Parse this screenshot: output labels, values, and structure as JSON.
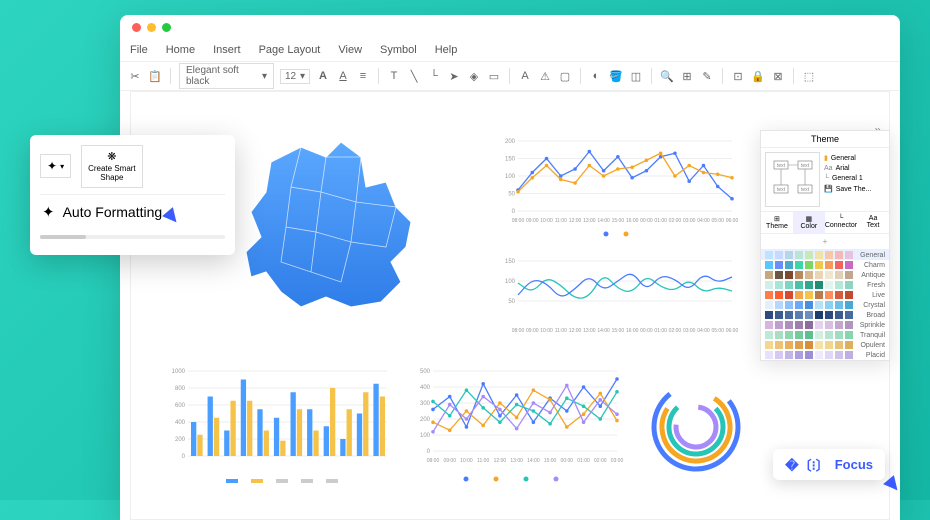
{
  "menu": {
    "file": "File",
    "home": "Home",
    "insert": "Insert",
    "layout": "Page Layout",
    "view": "View",
    "symbol": "Symbol",
    "help": "Help"
  },
  "toolbar": {
    "font": "Elegant soft black",
    "size": "12"
  },
  "popup": {
    "create_smart": "Create Smart\nShape",
    "auto_format": "Auto Formatting"
  },
  "theme": {
    "title": "Theme",
    "opts": [
      "General",
      "Arial",
      "General 1",
      "Save The..."
    ],
    "tabs": [
      "Theme",
      "Color",
      "Connector",
      "Text"
    ],
    "plus": "+",
    "rows": [
      "General",
      "Charm",
      "Antique",
      "Fresh",
      "Live",
      "Crystal",
      "Broad",
      "Sprinkle",
      "Tranquil",
      "Opulent",
      "Placid"
    ]
  },
  "focus": "Focus",
  "chart_data": [
    {
      "type": "line",
      "title": "",
      "x": [
        "08:00",
        "09:00",
        "10:00",
        "11:00",
        "12:00",
        "13:00",
        "14:00",
        "15:00",
        "16:00",
        "00:00",
        "01:00",
        "02:00",
        "03:00",
        "04:00",
        "05:00",
        "06:00"
      ],
      "series": [
        {
          "name": "blue",
          "values": [
            60,
            110,
            150,
            100,
            120,
            170,
            115,
            155,
            95,
            115,
            155,
            165,
            85,
            130,
            70,
            35
          ]
        },
        {
          "name": "yellow",
          "values": [
            55,
            95,
            130,
            90,
            80,
            130,
            100,
            120,
            125,
            145,
            165,
            100,
            130,
            110,
            105,
            95
          ]
        }
      ],
      "ylim": [
        0,
        200
      ],
      "yticks": [
        0,
        50,
        100,
        150,
        200
      ]
    },
    {
      "type": "line",
      "title": "",
      "x": [
        "08:00",
        "09:00",
        "10:00",
        "11:00",
        "12:00",
        "13:00",
        "14:00",
        "15:00",
        "16:00",
        "00:00",
        "01:00",
        "02:00",
        "03:00",
        "04:00",
        "05:00",
        "06:00"
      ],
      "series": [
        {
          "name": "teal",
          "values": [
            95,
            70,
            110,
            90,
            55,
            60,
            120,
            80,
            70,
            115,
            85,
            75,
            105,
            70,
            85,
            75
          ]
        },
        {
          "name": "blue",
          "values": [
            65,
            105,
            95,
            55,
            80,
            115,
            75,
            100,
            125,
            75,
            115,
            105,
            75,
            120,
            95,
            110
          ]
        }
      ],
      "ylim": [
        0,
        150
      ],
      "yticks": [
        50,
        100,
        150
      ]
    },
    {
      "type": "bar",
      "x": [
        "",
        "",
        "",
        "",
        "",
        "",
        "",
        "",
        "",
        "",
        "",
        ""
      ],
      "series": [
        {
          "name": "blue",
          "values": [
            400,
            700,
            300,
            900,
            550,
            450,
            750,
            550,
            350,
            200,
            500,
            850
          ]
        },
        {
          "name": "yellow",
          "values": [
            250,
            450,
            650,
            650,
            300,
            180,
            550,
            300,
            800,
            550,
            750,
            700
          ]
        }
      ],
      "ylim": [
        0,
        1000
      ],
      "yticks": [
        0,
        200,
        400,
        600,
        800,
        1000
      ]
    },
    {
      "type": "line",
      "x": [
        "08:00",
        "09:00",
        "10:00",
        "11:00",
        "12:00",
        "13:00",
        "14:00",
        "15:00",
        "00:00",
        "01:00",
        "02:00",
        "03:00"
      ],
      "series": [
        {
          "name": "a",
          "values": [
            260,
            340,
            150,
            420,
            220,
            350,
            180,
            330,
            250,
            400,
            280,
            450
          ]
        },
        {
          "name": "b",
          "values": [
            180,
            130,
            250,
            160,
            300,
            210,
            380,
            320,
            150,
            230,
            360,
            190
          ]
        },
        {
          "name": "c",
          "values": [
            310,
            220,
            380,
            270,
            180,
            290,
            250,
            170,
            330,
            280,
            200,
            370
          ]
        },
        {
          "name": "d",
          "values": [
            120,
            290,
            200,
            340,
            260,
            140,
            300,
            240,
            410,
            180,
            320,
            230
          ]
        }
      ],
      "ylim": [
        0,
        500
      ],
      "yticks": [
        0,
        100,
        200,
        300,
        400,
        500
      ]
    },
    {
      "type": "radial",
      "series": [
        {
          "r": 42,
          "c": "#4a7cff"
        },
        {
          "r": 34,
          "c": "#f5a623"
        },
        {
          "r": 27,
          "c": "#27c5b8"
        },
        {
          "r": 20,
          "c": "#a78bfa"
        }
      ]
    }
  ],
  "swatches": [
    [
      "#bfe3ff",
      "#c8d9ff",
      "#b5d6e8",
      "#b9e4d6",
      "#c8e8b8",
      "#f0e2a8",
      "#f5c9a8",
      "#f5b8b8",
      "#e5c2e0"
    ],
    [
      "#5bc5ff",
      "#6b8eff",
      "#4aa8c8",
      "#3dd6a8",
      "#7dd663",
      "#f0c94a",
      "#f5995c",
      "#f06363",
      "#c96bc2"
    ],
    [
      "#c5a882",
      "#6b5842",
      "#7d4a2f",
      "#b88b5c",
      "#d6b88e",
      "#e8d6b5",
      "#f0e5d0",
      "#e0d0b5",
      "#bfa88e"
    ],
    [
      "#d0efe8",
      "#a8e5d6",
      "#7dd6c2",
      "#4ac2a8",
      "#2fa88e",
      "#1f8e75",
      "#e0f5ed",
      "#b5e8d6",
      "#8ed6c2"
    ],
    [
      "#ff7d4a",
      "#ff5c2f",
      "#d64a2f",
      "#f0a84a",
      "#f5c24a",
      "#b87d4a",
      "#ff8e5c",
      "#d65c3d",
      "#c24a2f"
    ],
    [
      "#e0f0ff",
      "#b5d6ff",
      "#8ebfff",
      "#6ba8f5",
      "#4a8ee0",
      "#b5e0f5",
      "#8ed0f0",
      "#6bbfe8",
      "#4aa8d6"
    ],
    [
      "#2f4a7d",
      "#3d5c8e",
      "#4a6b9e",
      "#5c7daf",
      "#6b8ebf",
      "#1f3d6b",
      "#2f4a7d",
      "#3d5c8e",
      "#4a6b9e"
    ],
    [
      "#d6b5e0",
      "#c29ed0",
      "#af8ebf",
      "#9e7daf",
      "#8e6b9e",
      "#e5d0ed",
      "#d6bfe0",
      "#c2a8d0",
      "#af95bf"
    ],
    [
      "#bfe8d6",
      "#a8dec2",
      "#8ed6af",
      "#75c99e",
      "#5cbf8e",
      "#d0efe0",
      "#b5e5d0",
      "#9edebf",
      "#85d6af"
    ],
    [
      "#f5d68e",
      "#f0c275",
      "#e8af5c",
      "#e09e4a",
      "#d68e3d",
      "#f5e0a8",
      "#f0d68e",
      "#e8c275",
      "#e0af5c"
    ],
    [
      "#e8e0ff",
      "#d6c9f5",
      "#c2b5e8",
      "#af9ee0",
      "#9e8ed6",
      "#efe8ff",
      "#e0d6f5",
      "#d0c2ed",
      "#bfafe0"
    ]
  ]
}
